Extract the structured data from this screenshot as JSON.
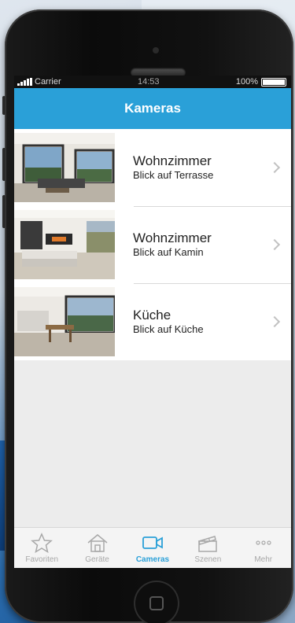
{
  "status_bar": {
    "carrier": "Carrier",
    "time": "14:53",
    "battery": "100%"
  },
  "nav": {
    "title": "Kameras"
  },
  "cameras": [
    {
      "title": "Wohnzimmer",
      "subtitle": "Blick auf Terrasse"
    },
    {
      "title": "Wohnzimmer",
      "subtitle": "Blick auf Kamin"
    },
    {
      "title": "Küche",
      "subtitle": "Blick auf Küche"
    }
  ],
  "tabs": [
    {
      "label": "Favoriten",
      "icon": "star-icon"
    },
    {
      "label": "Geräte",
      "icon": "house-icon"
    },
    {
      "label": "Cameras",
      "icon": "video-camera-icon"
    },
    {
      "label": "Szenen",
      "icon": "clapperboard-icon"
    },
    {
      "label": "Mehr",
      "icon": "more-dots-icon"
    }
  ],
  "colors": {
    "accent": "#2aa0d8",
    "tab_inactive": "#a8a8a8"
  }
}
